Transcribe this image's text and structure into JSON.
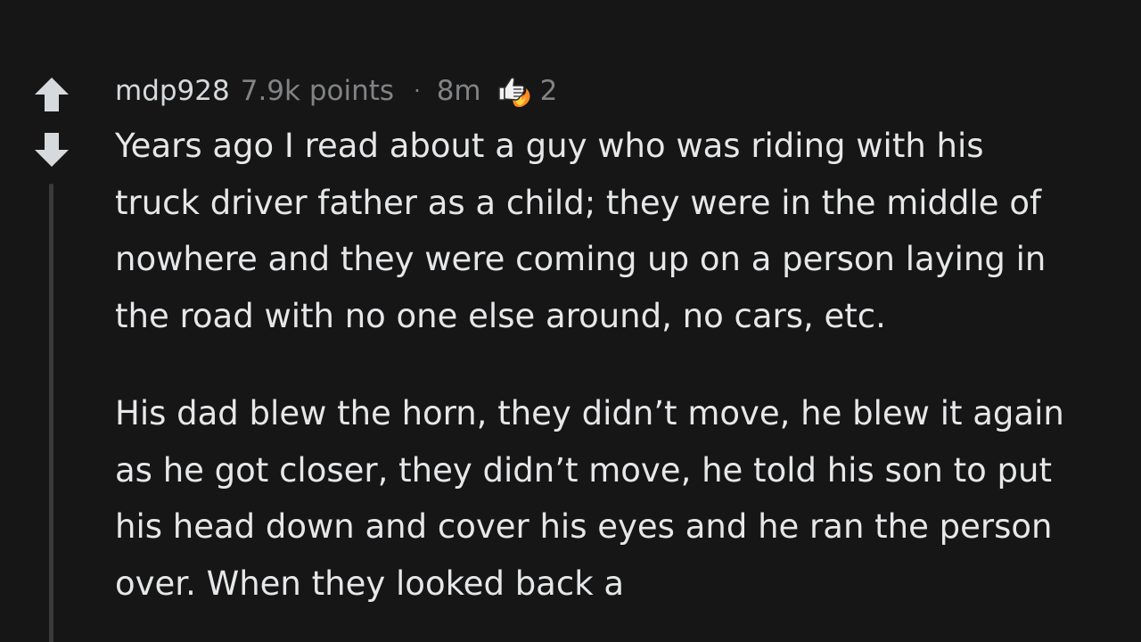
{
  "comment": {
    "username": "mdp928",
    "points": "7.9k points",
    "separator": "·",
    "age": "8m",
    "award_icon": "helpful-thumbs-up-icon",
    "award_count": "2",
    "paragraphs": [
      "Years ago I read about a guy who was riding with his truck driver father as a child; they were in the middle of nowhere and they were coming up on a person laying in the road with no one else around, no cars, etc.",
      "His dad blew the horn, they didn’t move, he blew it again as he got closer, they didn’t move, he told his son to put his head down and cover his eyes and he ran the person over. When they looked back a"
    ]
  },
  "colors": {
    "background": "#161617",
    "vote_arrow": "#d7dadc",
    "body_text": "#e6e7e8",
    "meta_text": "#818384",
    "thread_line": "#3a3a3c"
  }
}
